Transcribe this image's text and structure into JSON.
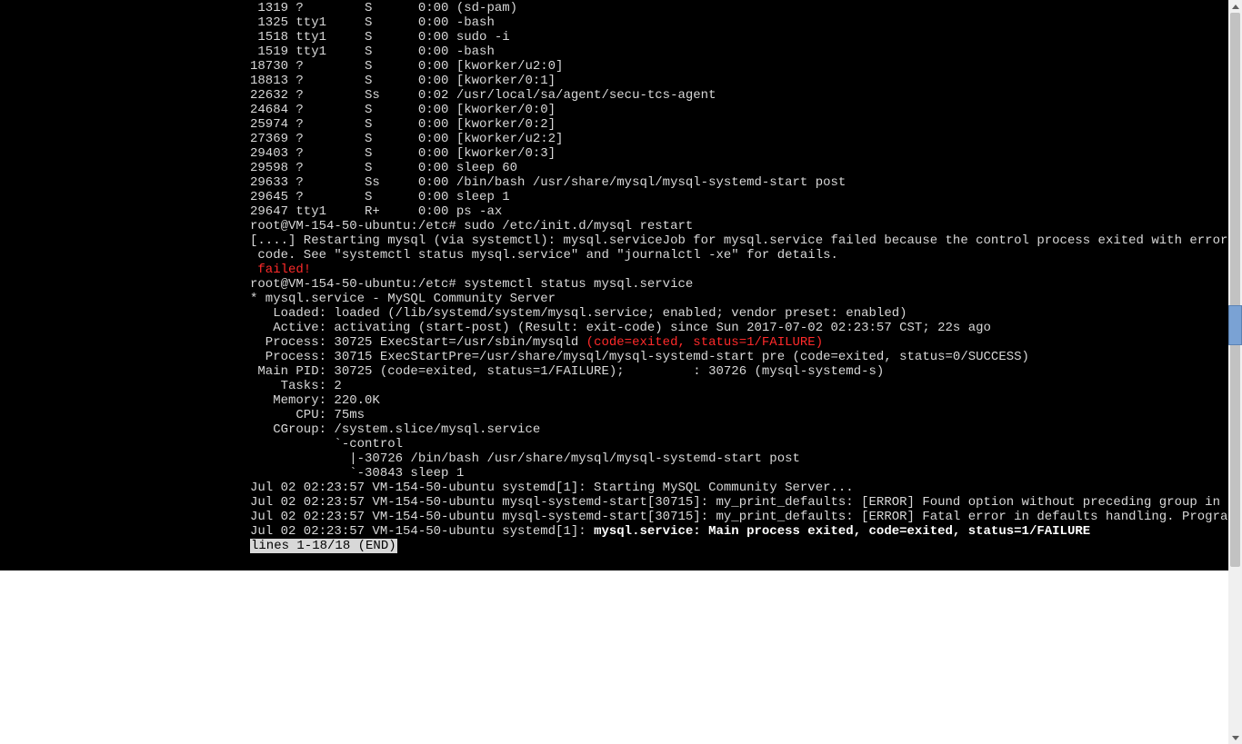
{
  "ps": [
    {
      "pid": "1319",
      "tty": "?",
      "stat": "S",
      "time": "0:00",
      "cmd": "(sd-pam)"
    },
    {
      "pid": "1325",
      "tty": "tty1",
      "stat": "S",
      "time": "0:00",
      "cmd": "-bash"
    },
    {
      "pid": "1518",
      "tty": "tty1",
      "stat": "S",
      "time": "0:00",
      "cmd": "sudo -i"
    },
    {
      "pid": "1519",
      "tty": "tty1",
      "stat": "S",
      "time": "0:00",
      "cmd": "-bash"
    },
    {
      "pid": "18730",
      "tty": "?",
      "stat": "S",
      "time": "0:00",
      "cmd": "[kworker/u2:0]"
    },
    {
      "pid": "18813",
      "tty": "?",
      "stat": "S",
      "time": "0:00",
      "cmd": "[kworker/0:1]"
    },
    {
      "pid": "22632",
      "tty": "?",
      "stat": "Ss",
      "time": "0:02",
      "cmd": "/usr/local/sa/agent/secu-tcs-agent"
    },
    {
      "pid": "24684",
      "tty": "?",
      "stat": "S",
      "time": "0:00",
      "cmd": "[kworker/0:0]"
    },
    {
      "pid": "25974",
      "tty": "?",
      "stat": "S",
      "time": "0:00",
      "cmd": "[kworker/0:2]"
    },
    {
      "pid": "27369",
      "tty": "?",
      "stat": "S",
      "time": "0:00",
      "cmd": "[kworker/u2:2]"
    },
    {
      "pid": "29403",
      "tty": "?",
      "stat": "S",
      "time": "0:00",
      "cmd": "[kworker/0:3]"
    },
    {
      "pid": "29598",
      "tty": "?",
      "stat": "S",
      "time": "0:00",
      "cmd": "sleep 60"
    },
    {
      "pid": "29633",
      "tty": "?",
      "stat": "Ss",
      "time": "0:00",
      "cmd": "/bin/bash /usr/share/mysql/mysql-systemd-start post"
    },
    {
      "pid": "29645",
      "tty": "?",
      "stat": "S",
      "time": "0:00",
      "cmd": "sleep 1"
    },
    {
      "pid": "29647",
      "tty": "tty1",
      "stat": "R+",
      "time": "0:00",
      "cmd": "ps -ax"
    }
  ],
  "prompt1": "root@VM-154-50-ubuntu:/etc# ",
  "cmd1": "sudo /etc/init.d/mysql restart",
  "restart_l1": "[....] Restarting mysql (via systemctl): mysql.serviceJob for mysql.service failed because the control process exited with error",
  "restart_l2": " code. See \"systemctl status mysql.service\" and \"journalctl -xe\" for details.",
  "failed": " failed!",
  "prompt2": "root@VM-154-50-ubuntu:/etc# ",
  "cmd2": "systemctl status mysql.service",
  "svc_header": "* mysql.service - MySQL Community Server",
  "svc_loaded": "   Loaded: loaded (/lib/systemd/system/mysql.service; enabled; vendor preset: enabled)",
  "svc_active": "   Active: activating (start-post) (Result: exit-code) since Sun 2017-07-02 02:23:57 CST; 22s ago",
  "svc_proc1a": "  Process: 30725 ExecStart=/usr/sbin/mysqld ",
  "svc_proc1b": "(code=exited, status=1/FAILURE)",
  "svc_proc2": "  Process: 30715 ExecStartPre=/usr/share/mysql/mysql-systemd-start pre (code=exited, status=0/SUCCESS)",
  "svc_pid": " Main PID: 30725 (code=exited, status=1/FAILURE);         : 30726 (mysql-systemd-s)",
  "svc_tasks": "    Tasks: 2",
  "svc_mem": "   Memory: 220.0K",
  "svc_cpu": "      CPU: 75ms",
  "svc_cgroup": "   CGroup: /system.slice/mysql.service",
  "svc_cg1": "           `-control",
  "svc_cg2": "             |-30726 /bin/bash /usr/share/mysql/mysql-systemd-start post",
  "svc_cg3": "             `-30843 sleep 1",
  "blank": "",
  "log1": "Jul 02 02:23:57 VM-154-50-ubuntu systemd[1]: Starting MySQL Community Server...",
  "log2": "Jul 02 02:23:57 VM-154-50-ubuntu mysql-systemd-start[30715]: my_print_defaults: [ERROR] Found option without preceding group in",
  "log3": "Jul 02 02:23:57 VM-154-50-ubuntu mysql-systemd-start[30715]: my_print_defaults: [ERROR] Fatal error in defaults handling. Progra",
  "log4a": "Jul 02 02:23:57 VM-154-50-ubuntu systemd[1]: ",
  "log4b": "mysql.service: Main process exited, code=exited, status=1/FAILURE",
  "pager": "lines 1-18/18 (END)"
}
